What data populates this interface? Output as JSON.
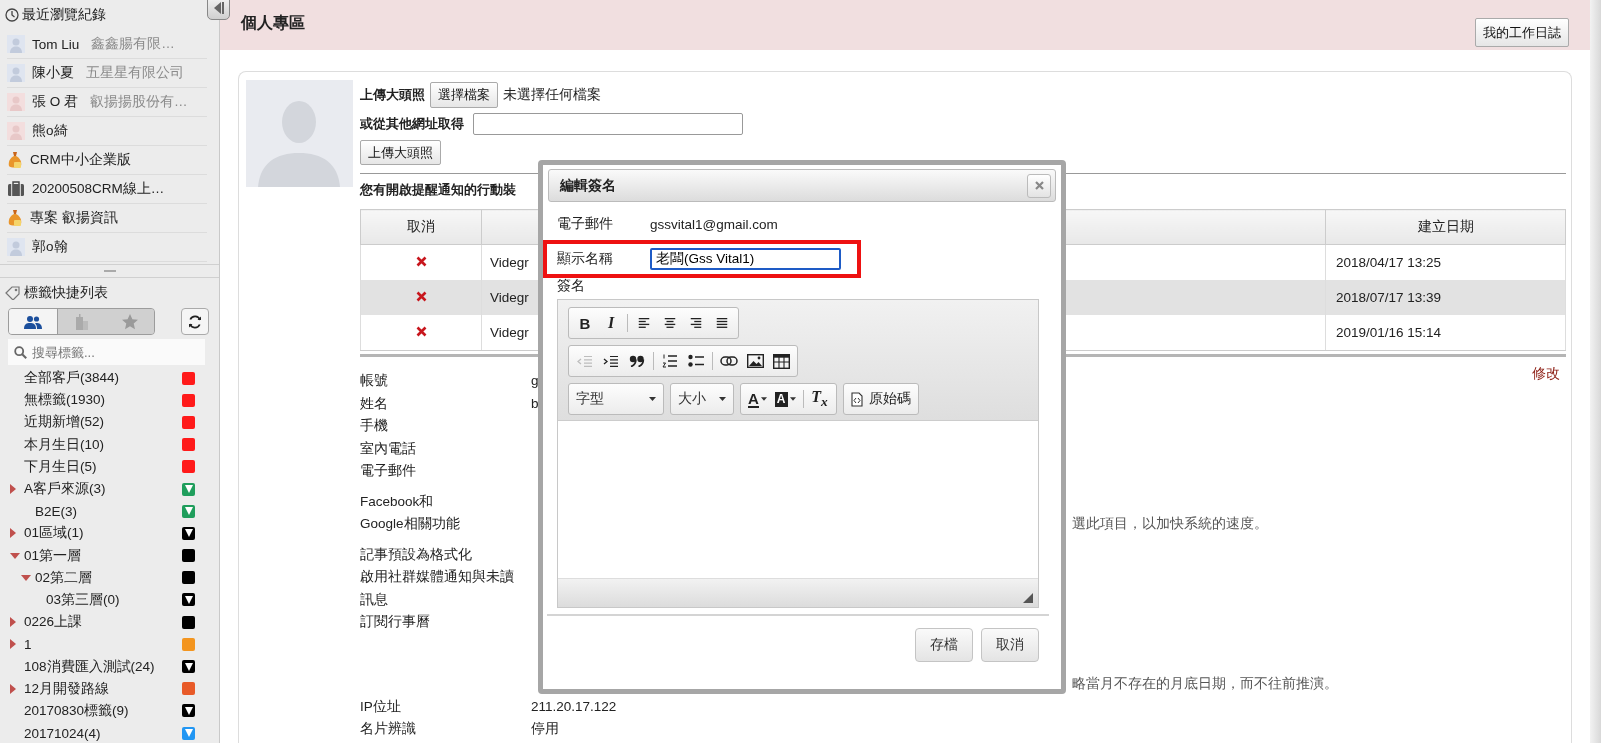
{
  "sidebar": {
    "recent": {
      "title": "最近瀏覽紀錄",
      "items": [
        {
          "kind": "person",
          "name": "Tom Liu",
          "company": "鑫鑫腸有限…"
        },
        {
          "kind": "person",
          "name": "陳小夏",
          "company": "五星星有限公司"
        },
        {
          "kind": "person-alt",
          "name": "張 O 君",
          "company": "叡揚揚股份有…"
        },
        {
          "kind": "person-alt",
          "name": "熊o綺"
        },
        {
          "kind": "money-bag",
          "name": "CRM中小企業版"
        },
        {
          "kind": "briefcase",
          "name": "20200508CRM線上…"
        },
        {
          "kind": "money-bag",
          "name": "專案 叡揚資訊"
        },
        {
          "kind": "person",
          "name": "郭o翰"
        }
      ]
    },
    "tags": {
      "title": "標籤快捷列表",
      "filters": [
        {
          "kind": "people",
          "selected": true
        },
        {
          "kind": "building",
          "selected": false
        },
        {
          "kind": "star",
          "selected": false
        }
      ],
      "search": {
        "placeholder": "搜尋標籤..."
      },
      "items": [
        {
          "label": "全部客戶(3844)",
          "kind": "square",
          "color": "#ff1a1a"
        },
        {
          "label": "無標籤(1930)",
          "kind": "square",
          "color": "#ff1a1a"
        },
        {
          "label": "近期新增(52)",
          "kind": "square",
          "color": "#ff1a1a"
        },
        {
          "label": "本月生日(10)",
          "kind": "square",
          "color": "#ff1a1a"
        },
        {
          "label": "下月生日(5)",
          "kind": "square",
          "color": "#ff1a1a"
        },
        {
          "label": "A客戶來源(3)",
          "kind": "filter",
          "color": "#1f9e5c",
          "expanded": false,
          "children": [
            {
              "label": "B2E(3)",
              "kind": "filter",
              "color": "#1f9e5c"
            }
          ]
        },
        {
          "label": "01區域(1)",
          "kind": "filter",
          "color": "#000000",
          "expanded": false
        },
        {
          "label": "01第一層",
          "kind": "square",
          "color": "#000000",
          "expanded": true,
          "children": [
            {
              "label": "02第二層",
              "kind": "square",
              "color": "#000000",
              "expanded": true,
              "children": [
                {
                  "label": "03第三層(0)",
                  "kind": "filter",
                  "color": "#000000"
                }
              ]
            }
          ]
        },
        {
          "label": "0226上課",
          "kind": "square",
          "color": "#000000",
          "expanded": false
        },
        {
          "label": "1",
          "kind": "square",
          "color": "#f3951f",
          "expanded": false
        },
        {
          "label": "108消費匯入測試(24)",
          "kind": "filter",
          "color": "#000000"
        },
        {
          "label": "12月開發路線",
          "kind": "square",
          "color": "#e85a28",
          "expanded": false
        },
        {
          "label": "20170830標籤(9)",
          "kind": "filter",
          "color": "#000000"
        },
        {
          "label": "20171024(4)",
          "kind": "filter",
          "color": "#2196f3"
        }
      ]
    }
  },
  "header": {
    "title": "個人專區",
    "button": "我的工作日誌"
  },
  "upload": {
    "label": "上傳大頭照",
    "file_button": "選擇檔案",
    "file_status": "未選擇任何檔案",
    "url_label": "或從其他網址取得",
    "submit": "上傳大頭照"
  },
  "devices": {
    "caption": "您有開啟提醒通知的行動裝",
    "column_1": "取消",
    "column_3": "建立日期",
    "rows": [
      {
        "device": "Videgr",
        "created": "2018/04/17 13:25",
        "selected": false
      },
      {
        "device": "Videgr",
        "created": "2018/07/17 13:39",
        "selected": true
      },
      {
        "device": "Videgr",
        "created": "2019/01/16 15:14",
        "selected": false
      }
    ]
  },
  "profile": {
    "edit_link": "修改",
    "rows": [
      {
        "kind": "value",
        "label": "帳號",
        "value": "g"
      },
      {
        "kind": "value",
        "label": "姓名",
        "value": "b"
      },
      {
        "kind": "value",
        "label": "手機"
      },
      {
        "kind": "value",
        "label": "室內電話"
      },
      {
        "kind": "value",
        "label": "電子郵件"
      },
      {
        "kind": "tail",
        "label": "Facebook和\nGoogle相關功能",
        "value": "選此項目，以加快系統的速度。"
      },
      {
        "kind": "value",
        "label": "記事預設為格式化"
      },
      {
        "kind": "value",
        "label": "啟用社群媒體通知與未讀訊息"
      },
      {
        "kind": "note",
        "label": "訂閱行事曆",
        "value": "略當月不存在的月底日期，而不往前推演。"
      },
      {
        "kind": "value",
        "label": "IP位址",
        "value": "211.20.17.122"
      },
      {
        "kind": "value",
        "label": "名片辨識",
        "value": "停用"
      }
    ]
  },
  "dialog": {
    "title": "編輯簽名",
    "fields": [
      {
        "kind": "text",
        "label": "電子郵件",
        "value": "gssvital1@gmail.com"
      },
      {
        "kind": "input",
        "label": "顯示名稱",
        "value": "老闆(Gss Vital1)",
        "highlighted": true
      }
    ],
    "signature_label": "簽名",
    "toolbar": [
      [
        {
          "items": [
            {
              "kind": "bold",
              "label": "B"
            },
            {
              "kind": "italic",
              "label": "I"
            },
            {
              "kind": "sep"
            },
            {
              "kind": "align-left"
            },
            {
              "kind": "align-center"
            },
            {
              "kind": "align-right"
            },
            {
              "kind": "justify"
            }
          ]
        }
      ],
      [
        {
          "items": [
            {
              "kind": "outdent",
              "disabled": true
            },
            {
              "kind": "indent"
            },
            {
              "kind": "blockquote"
            },
            {
              "kind": "sep"
            },
            {
              "kind": "numbered-list"
            },
            {
              "kind": "bulleted-list"
            },
            {
              "kind": "sep"
            },
            {
              "kind": "link"
            },
            {
              "kind": "image"
            },
            {
              "kind": "table"
            }
          ]
        }
      ],
      [
        {
          "items": [
            {
              "kind": "dropdown",
              "label": "字型"
            }
          ]
        },
        {
          "items": [
            {
              "kind": "dropdown",
              "label": "大小"
            }
          ]
        },
        {
          "items": [
            {
              "kind": "text-color",
              "label": "A"
            },
            {
              "kind": "background-color",
              "label": "A"
            },
            {
              "kind": "sep"
            },
            {
              "kind": "remove-format",
              "label": "T$_{x}$"
            }
          ]
        },
        {
          "items": [
            {
              "kind": "source",
              "label": "原始碼"
            }
          ]
        }
      ]
    ],
    "buttons": [
      {
        "label": "存檔"
      },
      {
        "label": "取消"
      }
    ]
  }
}
